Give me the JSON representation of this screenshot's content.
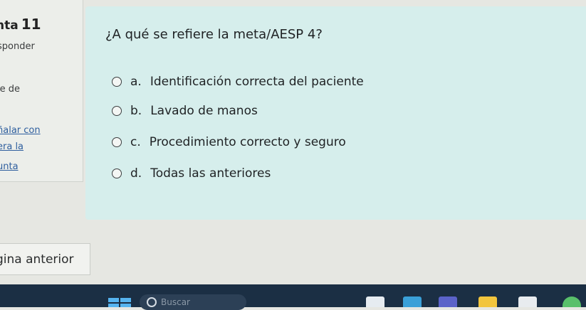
{
  "sidebar": {
    "question_label": "nta",
    "question_number": "11",
    "respond_text": "sponder",
    "grade_text": "je de",
    "flag_link_1": "ñalar con",
    "flag_link_2": "era la",
    "flag_link_3": "unta"
  },
  "question": {
    "text": "¿A qué se refiere la meta/AESP 4?",
    "options": [
      {
        "letter": "a.",
        "label": "Identificación correcta del paciente"
      },
      {
        "letter": "b.",
        "label": "Lavado de manos"
      },
      {
        "letter": "c.",
        "label": "Procedimiento correcto y seguro"
      },
      {
        "letter": "d.",
        "label": "Todas las anteriores"
      }
    ]
  },
  "navigation": {
    "prev_label": "gina anterior"
  },
  "taskbar": {
    "search_placeholder": "Buscar",
    "colors": {
      "background": "#1b2f44",
      "accent": "#56b4ef"
    }
  }
}
